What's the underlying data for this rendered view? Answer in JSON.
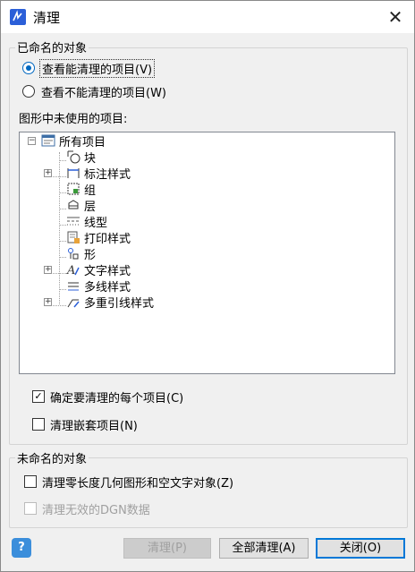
{
  "window": {
    "title": "清理",
    "close_glyph": "✕"
  },
  "named_group": {
    "label": "已命名的对象",
    "radio_purgeable": "查看能清理的项目(V)",
    "radio_unpurgeable": "查看不能清理的项目(W)",
    "tree_heading": "图形中未使用的项目:",
    "tree": {
      "root": "所有项目",
      "items": [
        "块",
        "标注样式",
        "组",
        "层",
        "线型",
        "打印样式",
        "形",
        "文字样式",
        "多线样式",
        "多重引线样式"
      ]
    },
    "check_confirm": "确定要清理的每个项目(C)",
    "check_nested": "清理嵌套项目(N)"
  },
  "unnamed_group": {
    "label": "未命名的对象",
    "check_zero_length": "清理零长度几何图形和空文字对象(Z)",
    "check_dgn": "清理无效的DGN数据"
  },
  "buttons": {
    "help": "?",
    "purge": "清理(P)",
    "purge_all": "全部清理(A)",
    "close": "关闭(O)"
  },
  "colors": {
    "accent": "#0067c0",
    "help_bg": "#3b8edb"
  }
}
